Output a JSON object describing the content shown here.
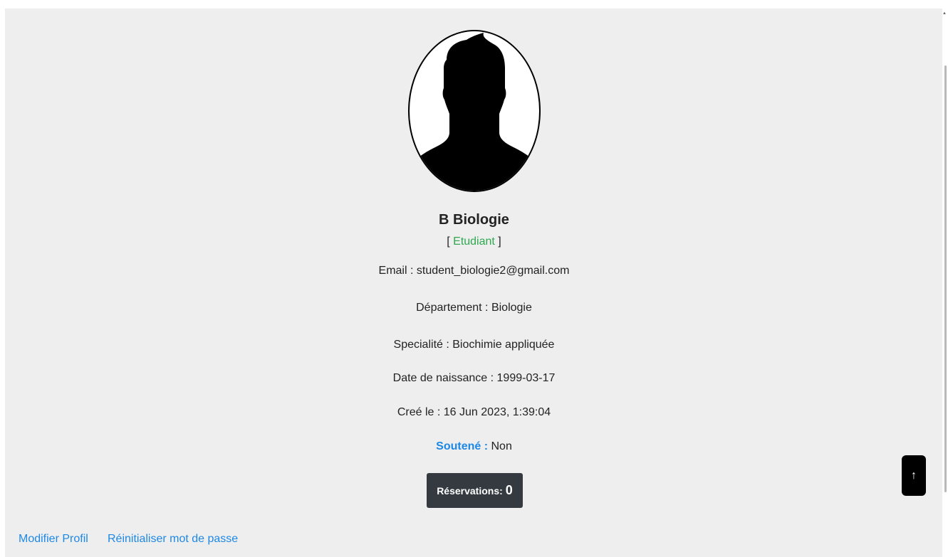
{
  "profile": {
    "name": "B Biologie",
    "role_open": "[ ",
    "role": "Etudiant",
    "role_close": " ]",
    "email_label": "Email : ",
    "email": "student_biologie2@gmail.com",
    "department_label": "Département : ",
    "department": "Biologie",
    "specialty_label": "Specialité : ",
    "specialty": "Biochimie appliquée",
    "birthdate_label": "Date de naissance : ",
    "birthdate": "1999-03-17",
    "created_label": "Creé le : ",
    "created": "16 Jun 2023, 1:39:04",
    "soutene_label": "Soutené : ",
    "soutene": "Non"
  },
  "reservations": {
    "label": "Réservations:",
    "count": "0"
  },
  "scroll_top": {
    "icon": "↑"
  },
  "links": {
    "edit_profile": "Modifier Profil",
    "reset_password": "Réinitialiser mot de passe"
  },
  "colors": {
    "role": "#2fa84f",
    "accent": "#1e88e5",
    "button_dark": "#343a40",
    "background": "#eeeeee"
  }
}
